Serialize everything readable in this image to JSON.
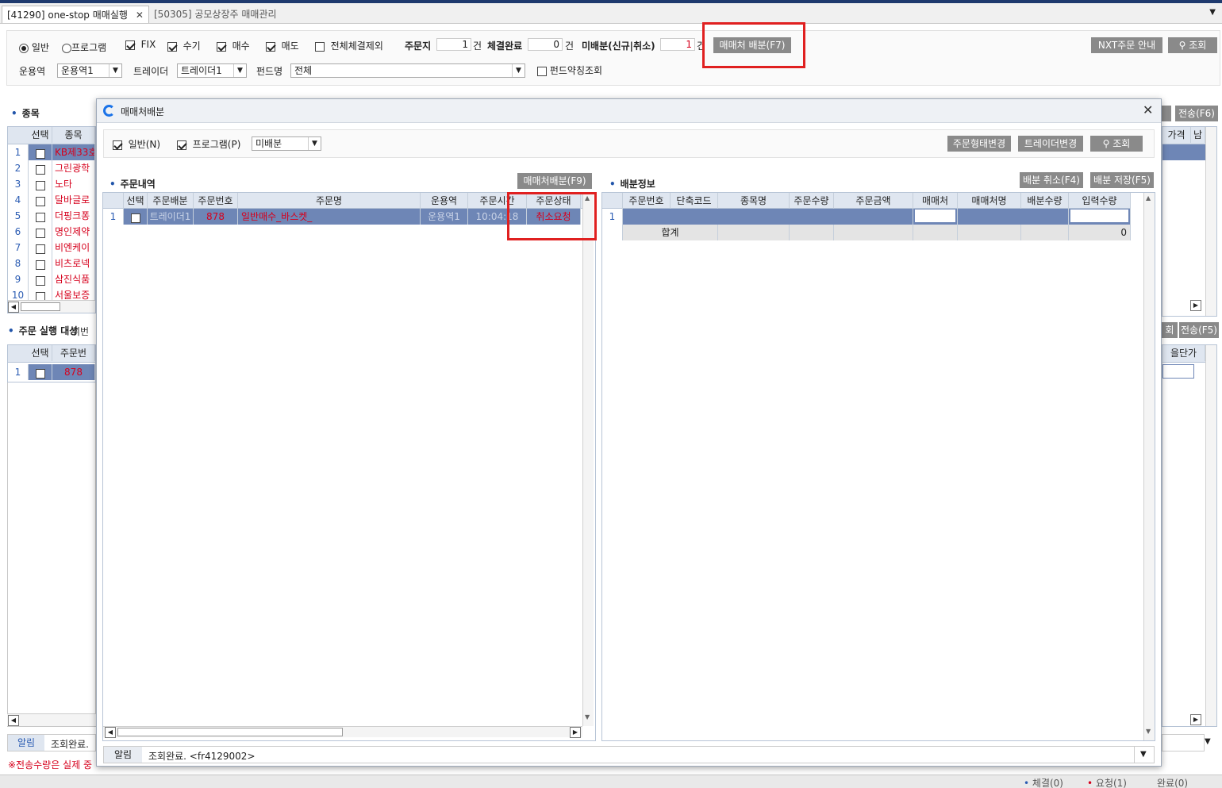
{
  "tabs": [
    {
      "label": "[41290] one-stop 매매실행",
      "close": "✕"
    },
    {
      "label": "[50305] 공모상장주 매매관리"
    }
  ],
  "filters": {
    "radio_general": "일반",
    "radio_program": "프로그램",
    "chk_fix": "FIX",
    "chk_manual": "수기",
    "chk_buy": "매수",
    "chk_sell": "매도",
    "chk_exclude_all": "전체체결제외",
    "order_label": "주문지",
    "order_count": "1",
    "filled_label": "체결완료",
    "filled_count": "0",
    "unalloc_label": "미배분(신규|취소)",
    "unalloc_count": "1",
    "unit": "건",
    "alloc_button": "매매처 배분(F7)",
    "nxt_button": "NXT주문 안내",
    "search_button": "조회",
    "operator_label": "운용역",
    "operator_value": "운용역1",
    "trader_label": "트레이더",
    "trader_value": "트레이더1",
    "fund_label": "펀드명",
    "fund_value": "전체",
    "fund_abbr": "펀드약칭조회"
  },
  "bg_left": {
    "section_title": "종목",
    "col_select": "선택",
    "col_item": "종목",
    "rows": [
      {
        "no": "1",
        "name": "KB제33호"
      },
      {
        "no": "2",
        "name": "그린광학"
      },
      {
        "no": "3",
        "name": "노타"
      },
      {
        "no": "4",
        "name": "달바글로"
      },
      {
        "no": "5",
        "name": "더핑크퐁"
      },
      {
        "no": "6",
        "name": "명인제약"
      },
      {
        "no": "7",
        "name": "비엔케이"
      },
      {
        "no": "8",
        "name": "비츠로넥"
      },
      {
        "no": "9",
        "name": "삼진식품"
      },
      {
        "no": "10",
        "name": "서울보증"
      }
    ],
    "section2_title": "주문 실행 대상",
    "section2_overlap": "취번",
    "col2_select": "선택",
    "col2_order": "주문번",
    "row2_no": "1",
    "row2_order": "878",
    "alert_label": "알림",
    "alert_text": "조회완료. ",
    "footnote": "※전송수량은 실제 중"
  },
  "bg_right": {
    "send_f6": "전송(F6)",
    "col_price": "가격",
    "col_remain": "남",
    "search_partial": "회",
    "send_f5": "전송(F5)",
    "col_unit_price": "을단가"
  },
  "status": {
    "fill": "체결(0)",
    "request": "요청(1)",
    "done": "완료(0)"
  },
  "dialog": {
    "title": "매매처배분",
    "chk_general": "일반(N)",
    "chk_program": "프로그램(P)",
    "select_value": "미배분",
    "btn_order_type": "주문형태변경",
    "btn_trader_change": "트레이더변경",
    "btn_search": "조회",
    "left_section": "주문내역",
    "left_alloc_button": "매매처배분(F9)",
    "left_columns": [
      "선택",
      "주문배분",
      "주문번호",
      "주문명",
      "운용역",
      "주문시간",
      "주문상태"
    ],
    "left_row": {
      "no": "1",
      "alloc": "트레이더1",
      "order_no": "878",
      "order_name": "일반매수_바스켓_",
      "operator": "운용역1",
      "time": "10:04:18",
      "status": "취소요청"
    },
    "right_section": "배분정보",
    "btn_cancel_alloc": "배분 취소(F4)",
    "btn_save_alloc": "배분 저장(F5)",
    "right_columns": [
      "주문번호",
      "단축코드",
      "종목명",
      "주문수량",
      "주문금액",
      "매매처",
      "매매처명",
      "배분수량",
      "입력수량"
    ],
    "right_row_no": "1",
    "total_label": "합계",
    "total_value": "0",
    "alert_label": "알림",
    "alert_text": "조회완료. <fr4129002>"
  }
}
